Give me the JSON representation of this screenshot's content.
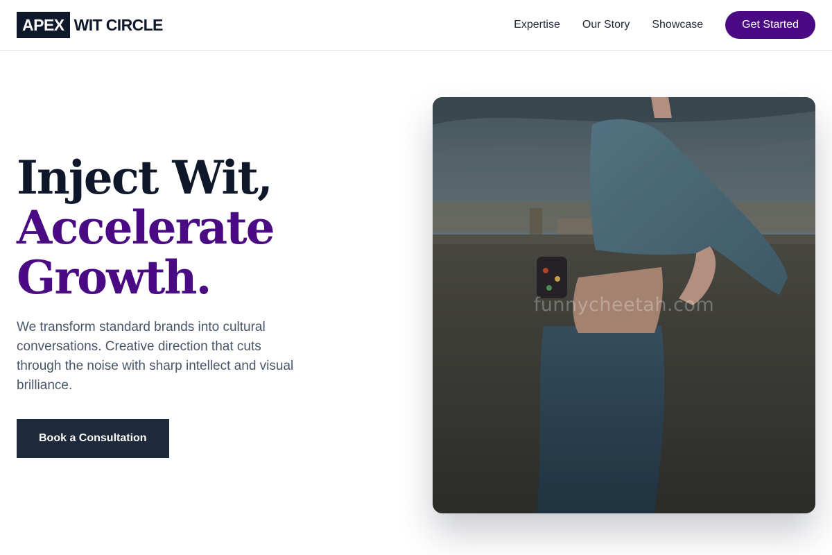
{
  "nav": {
    "logo_box": "APEX",
    "logo_rest": "WIT CIRCLE",
    "links": [
      "Expertise",
      "Our Story",
      "Showcase"
    ],
    "cta": "Get Started"
  },
  "hero": {
    "headline": [
      "Inject Wit,",
      "Accelerate",
      "Growth."
    ],
    "subtext": "We transform standard brands into cultural conversations. Creative direction that cuts through the noise with sharp intellect and visual brilliance.",
    "cta": "Book a Consultation",
    "image_watermark": "funnycheetah.com"
  },
  "colors": {
    "brand_purple": "#4a0a84",
    "dark_navy": "#0f172a",
    "button_dark": "#1e293b"
  }
}
